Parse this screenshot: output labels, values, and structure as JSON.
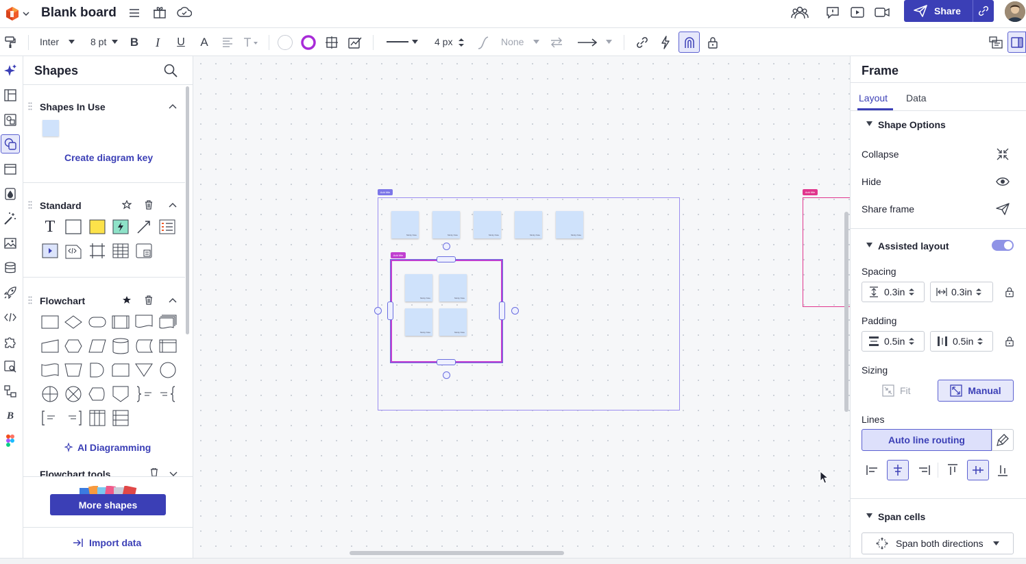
{
  "app": {
    "title": "Blank board",
    "share_label": "Share"
  },
  "toolbar": {
    "font": "Inter",
    "font_size": "8 pt",
    "line_width": "4 px",
    "arrow_start": "None"
  },
  "shapes_panel": {
    "title": "Shapes",
    "in_use_title": "Shapes In Use",
    "create_key": "Create diagram key",
    "standard_title": "Standard",
    "flowchart_title": "Flowchart",
    "ai_diagramming": "AI Diagramming",
    "flowchart_tools": "Flowchart tools",
    "more_shapes": "More shapes",
    "import_data": "Import data"
  },
  "canvas": {
    "frame_label": "Add title",
    "sticky_text": "Sticky Note"
  },
  "right_panel": {
    "title": "Frame",
    "tabs": [
      "Layout",
      "Data"
    ],
    "shape_options": "Shape Options",
    "collapse": "Collapse",
    "hide": "Hide",
    "share_frame": "Share frame",
    "assisted_layout": "Assisted layout",
    "spacing": "Spacing",
    "spacing_v": "0.3in",
    "spacing_h": "0.3in",
    "padding": "Padding",
    "padding_v": "0.5in",
    "padding_h": "0.5in",
    "sizing": "Sizing",
    "fit": "Fit",
    "manual": "Manual",
    "lines": "Lines",
    "auto_line_routing": "Auto line routing",
    "span_cells": "Span cells",
    "span_both": "Span both directions"
  },
  "colors": {
    "accent": "#3b3fb6",
    "frame_border": "#9b8df0",
    "selection": "#c03fd0",
    "sticky": "#cfe2fb",
    "logo_orange": "#f05a28"
  }
}
